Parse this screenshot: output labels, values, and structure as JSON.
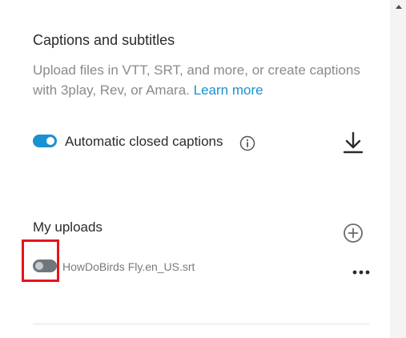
{
  "captions": {
    "title": "Captions and subtitles",
    "description": "Upload files in VTT, SRT, and more, or create captions with 3play, Rev, or Amara.",
    "learn_more": "Learn more"
  },
  "auto_captions": {
    "label": "Automatic closed captions",
    "enabled": true
  },
  "uploads": {
    "title": "My uploads",
    "files": [
      {
        "name": "HowDoBirds Fly.en_US.srt",
        "enabled": false
      }
    ]
  },
  "icons": {
    "info": "info-icon",
    "download": "download-icon",
    "add": "add-icon",
    "more": "more-horizontal-icon"
  },
  "colors": {
    "accent": "#1a91d0",
    "highlight": "#e8131a"
  }
}
